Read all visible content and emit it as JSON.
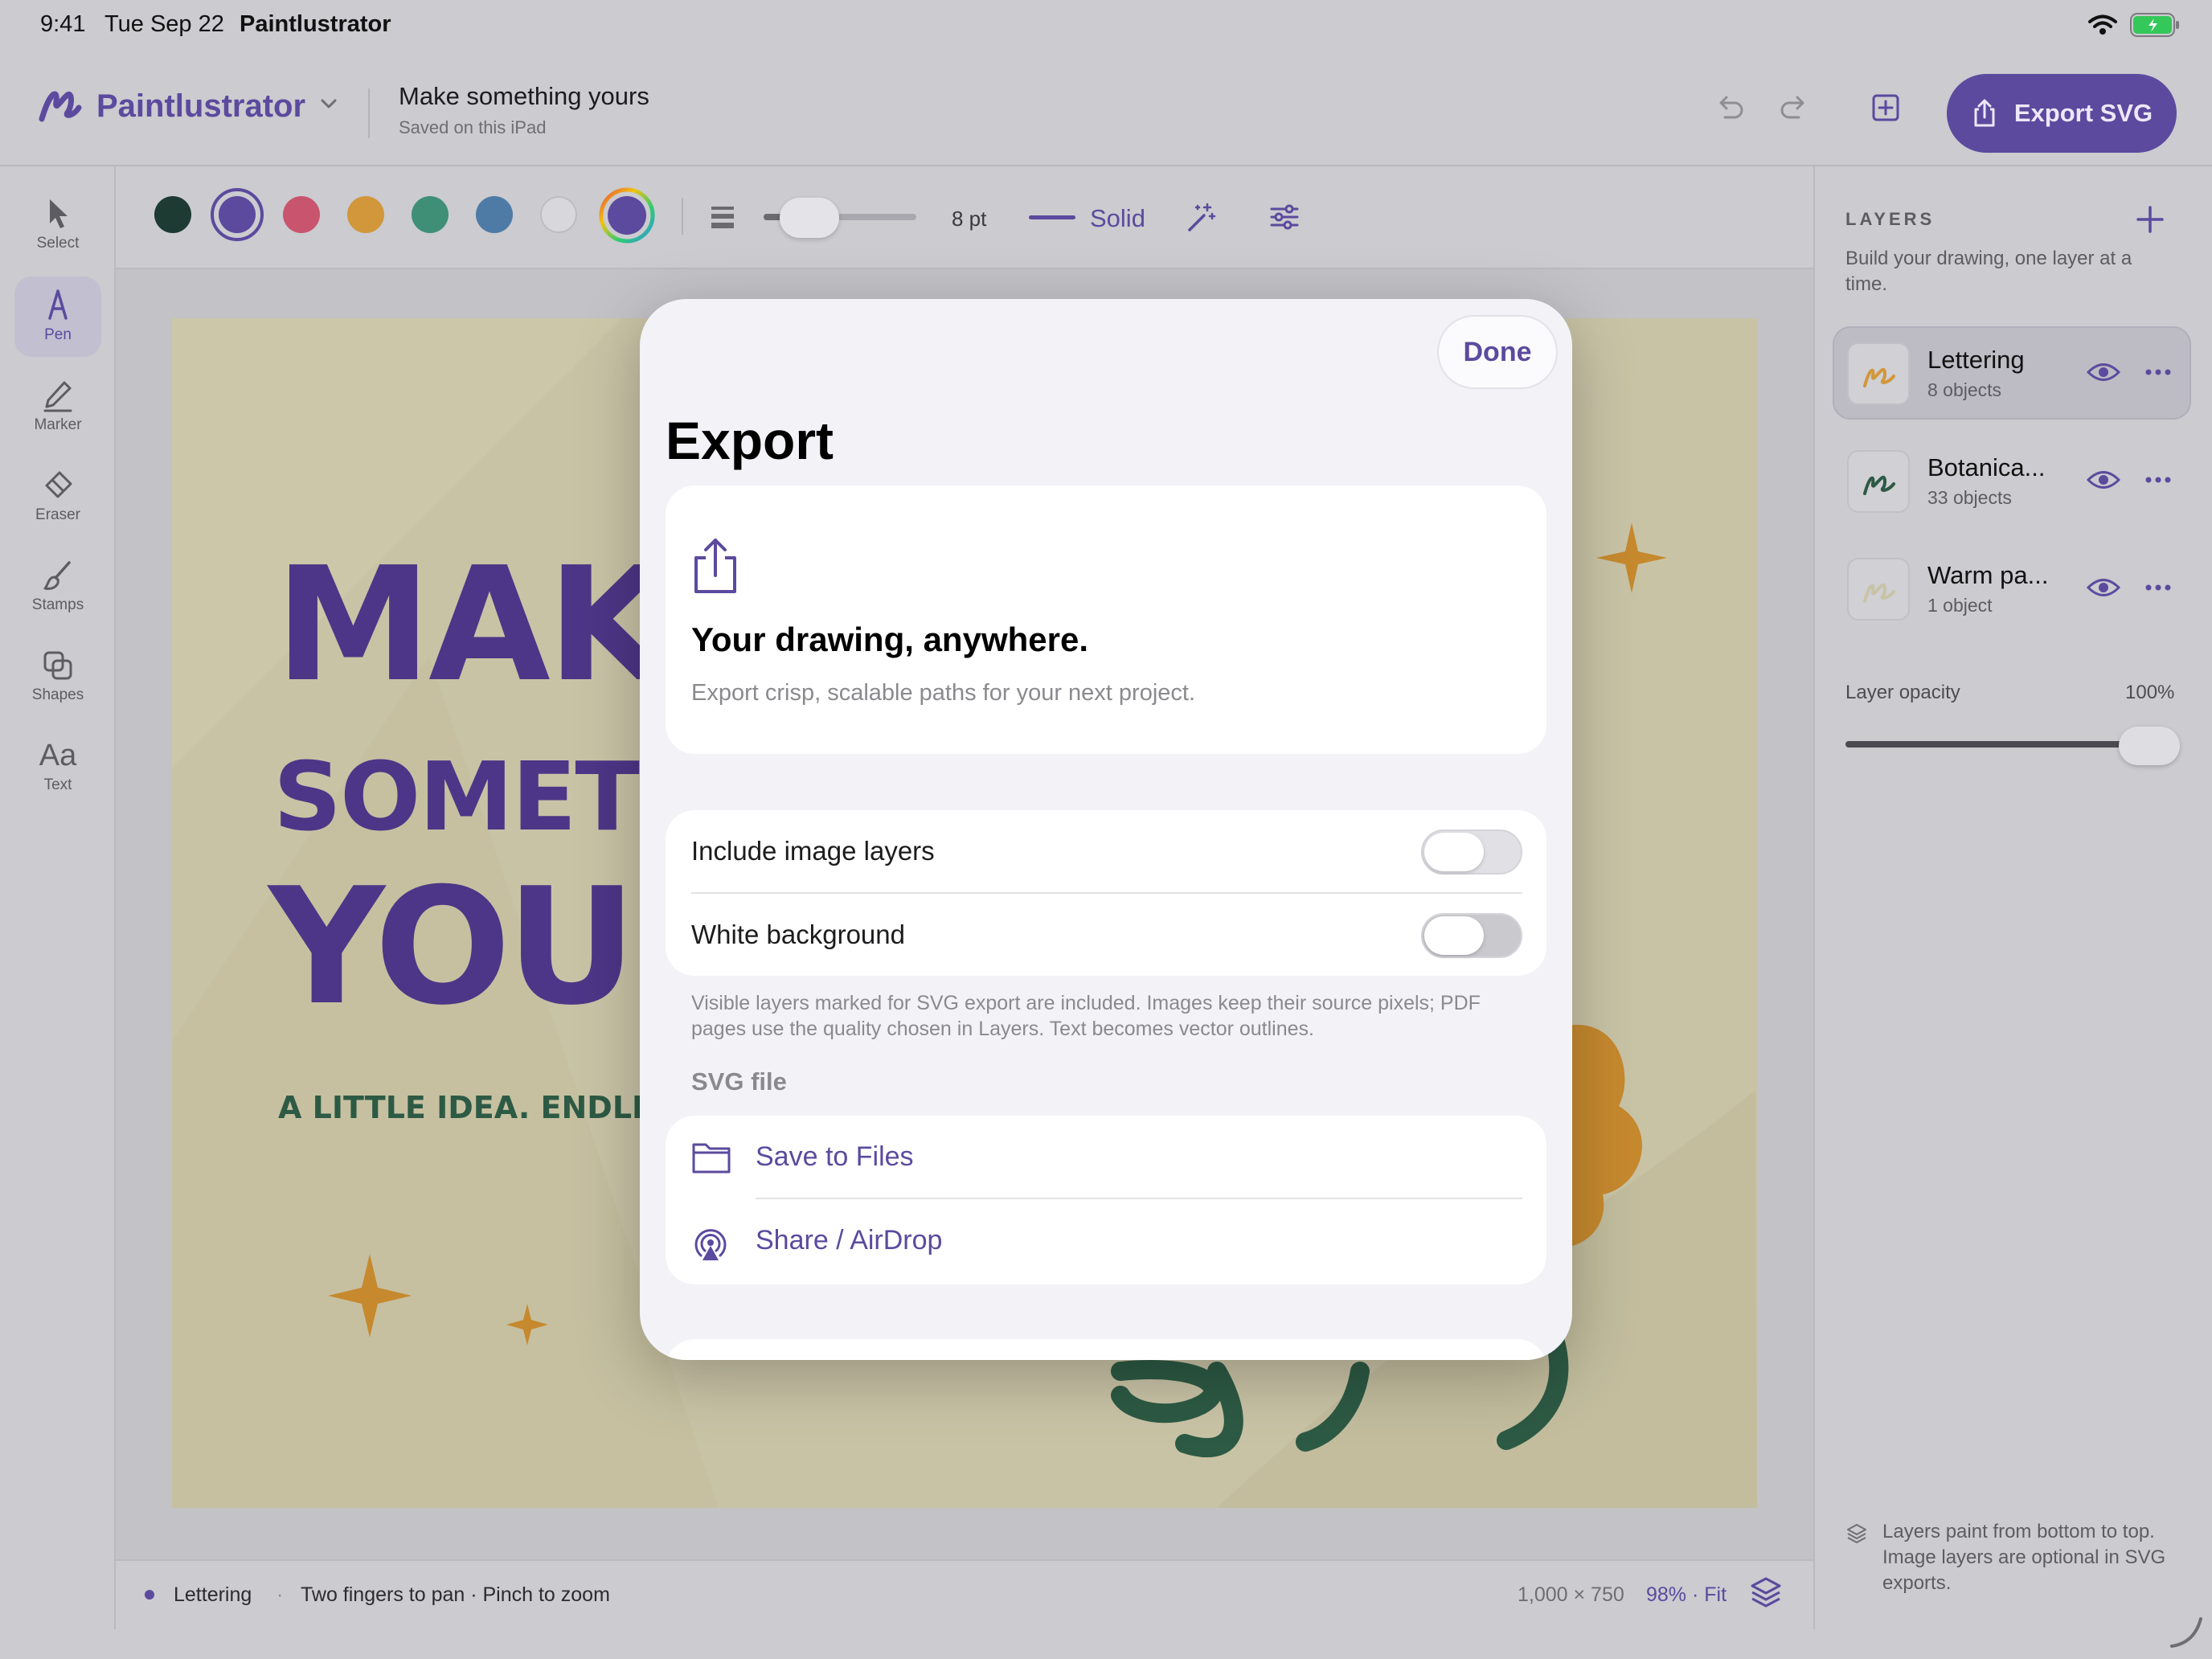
{
  "status_bar": {
    "time": "9:41",
    "date": "Tue Sep 22",
    "app_name": "Paintlustrator",
    "battery_color": "#34c759"
  },
  "header": {
    "brand": "Paintlustrator",
    "doc_title": "Make something yours",
    "doc_subtitle": "Saved on this iPad",
    "export_button": "Export SVG",
    "icons": [
      "undo-icon",
      "redo-icon",
      "add-page-icon"
    ]
  },
  "tools": [
    {
      "label": "Select",
      "icon": "pointer-icon",
      "active": false
    },
    {
      "label": "Pen",
      "icon": "pen-icon",
      "active": true
    },
    {
      "label": "Marker",
      "icon": "marker-icon",
      "active": false
    },
    {
      "label": "Eraser",
      "icon": "eraser-icon",
      "active": false
    },
    {
      "label": "Stamps",
      "icon": "brush-icon",
      "active": false
    },
    {
      "label": "Shapes",
      "icon": "shapes-icon",
      "active": false
    },
    {
      "label": "Text",
      "icon": "text-icon",
      "active": false
    }
  ],
  "toolbar": {
    "swatches": [
      "#1d3a33",
      "#5b4a9e",
      "#c9546e",
      "#d2973a",
      "#3f8f76",
      "#4d7ba6",
      "#d8d8dc"
    ],
    "selected_swatch": "#5b4a9e",
    "stroke_size": "8 pt",
    "stroke_size_value": 8,
    "line_style": "Solid"
  },
  "artboard": {
    "line1": "MAK",
    "line2": "SOMETI",
    "line3": "YOU",
    "tagline": "A LITTLE IDEA. ENDLESS I",
    "colors": {
      "paper": "#c9c3a6",
      "lettering": "#4d3687",
      "accent": "#c6892e",
      "green": "#2d5a44"
    }
  },
  "bottom_bar": {
    "active_layer": "Lettering",
    "hint": "Two fingers to pan · Pinch to zoom",
    "dimensions": "1,000 × 750",
    "zoom": "98% · Fit"
  },
  "layers_panel": {
    "title": "LAYERS",
    "description": "Build your drawing, one layer at a time.",
    "layers": [
      {
        "name": "Lettering",
        "count": "8 objects",
        "selected": true
      },
      {
        "name": "Botanica...",
        "count": "33 objects",
        "selected": false
      },
      {
        "name": "Warm pa...",
        "count": "1 object",
        "selected": false
      }
    ],
    "opacity_label": "Layer opacity",
    "opacity_value": "100%",
    "opacity_fraction": 1.0,
    "footer": "Layers paint from bottom to top. Image layers are optional in SVG exports."
  },
  "export_sheet": {
    "done": "Done",
    "title": "Export",
    "hero_title": "Your drawing, anywhere.",
    "hero_subtitle": "Export crisp, scalable paths for your next project.",
    "options": [
      {
        "label": "Include image layers",
        "on": false
      },
      {
        "label": "White background",
        "on": false
      }
    ],
    "footnote": "Visible layers marked for SVG export are included. Images keep their source pixels; PDF pages use the quality chosen in Layers. Text becomes vector outlines.",
    "section_header": "SVG file",
    "actions": [
      {
        "label": "Save to Files",
        "icon": "folder-icon"
      },
      {
        "label": "Share / AirDrop",
        "icon": "airdrop-icon"
      }
    ]
  }
}
